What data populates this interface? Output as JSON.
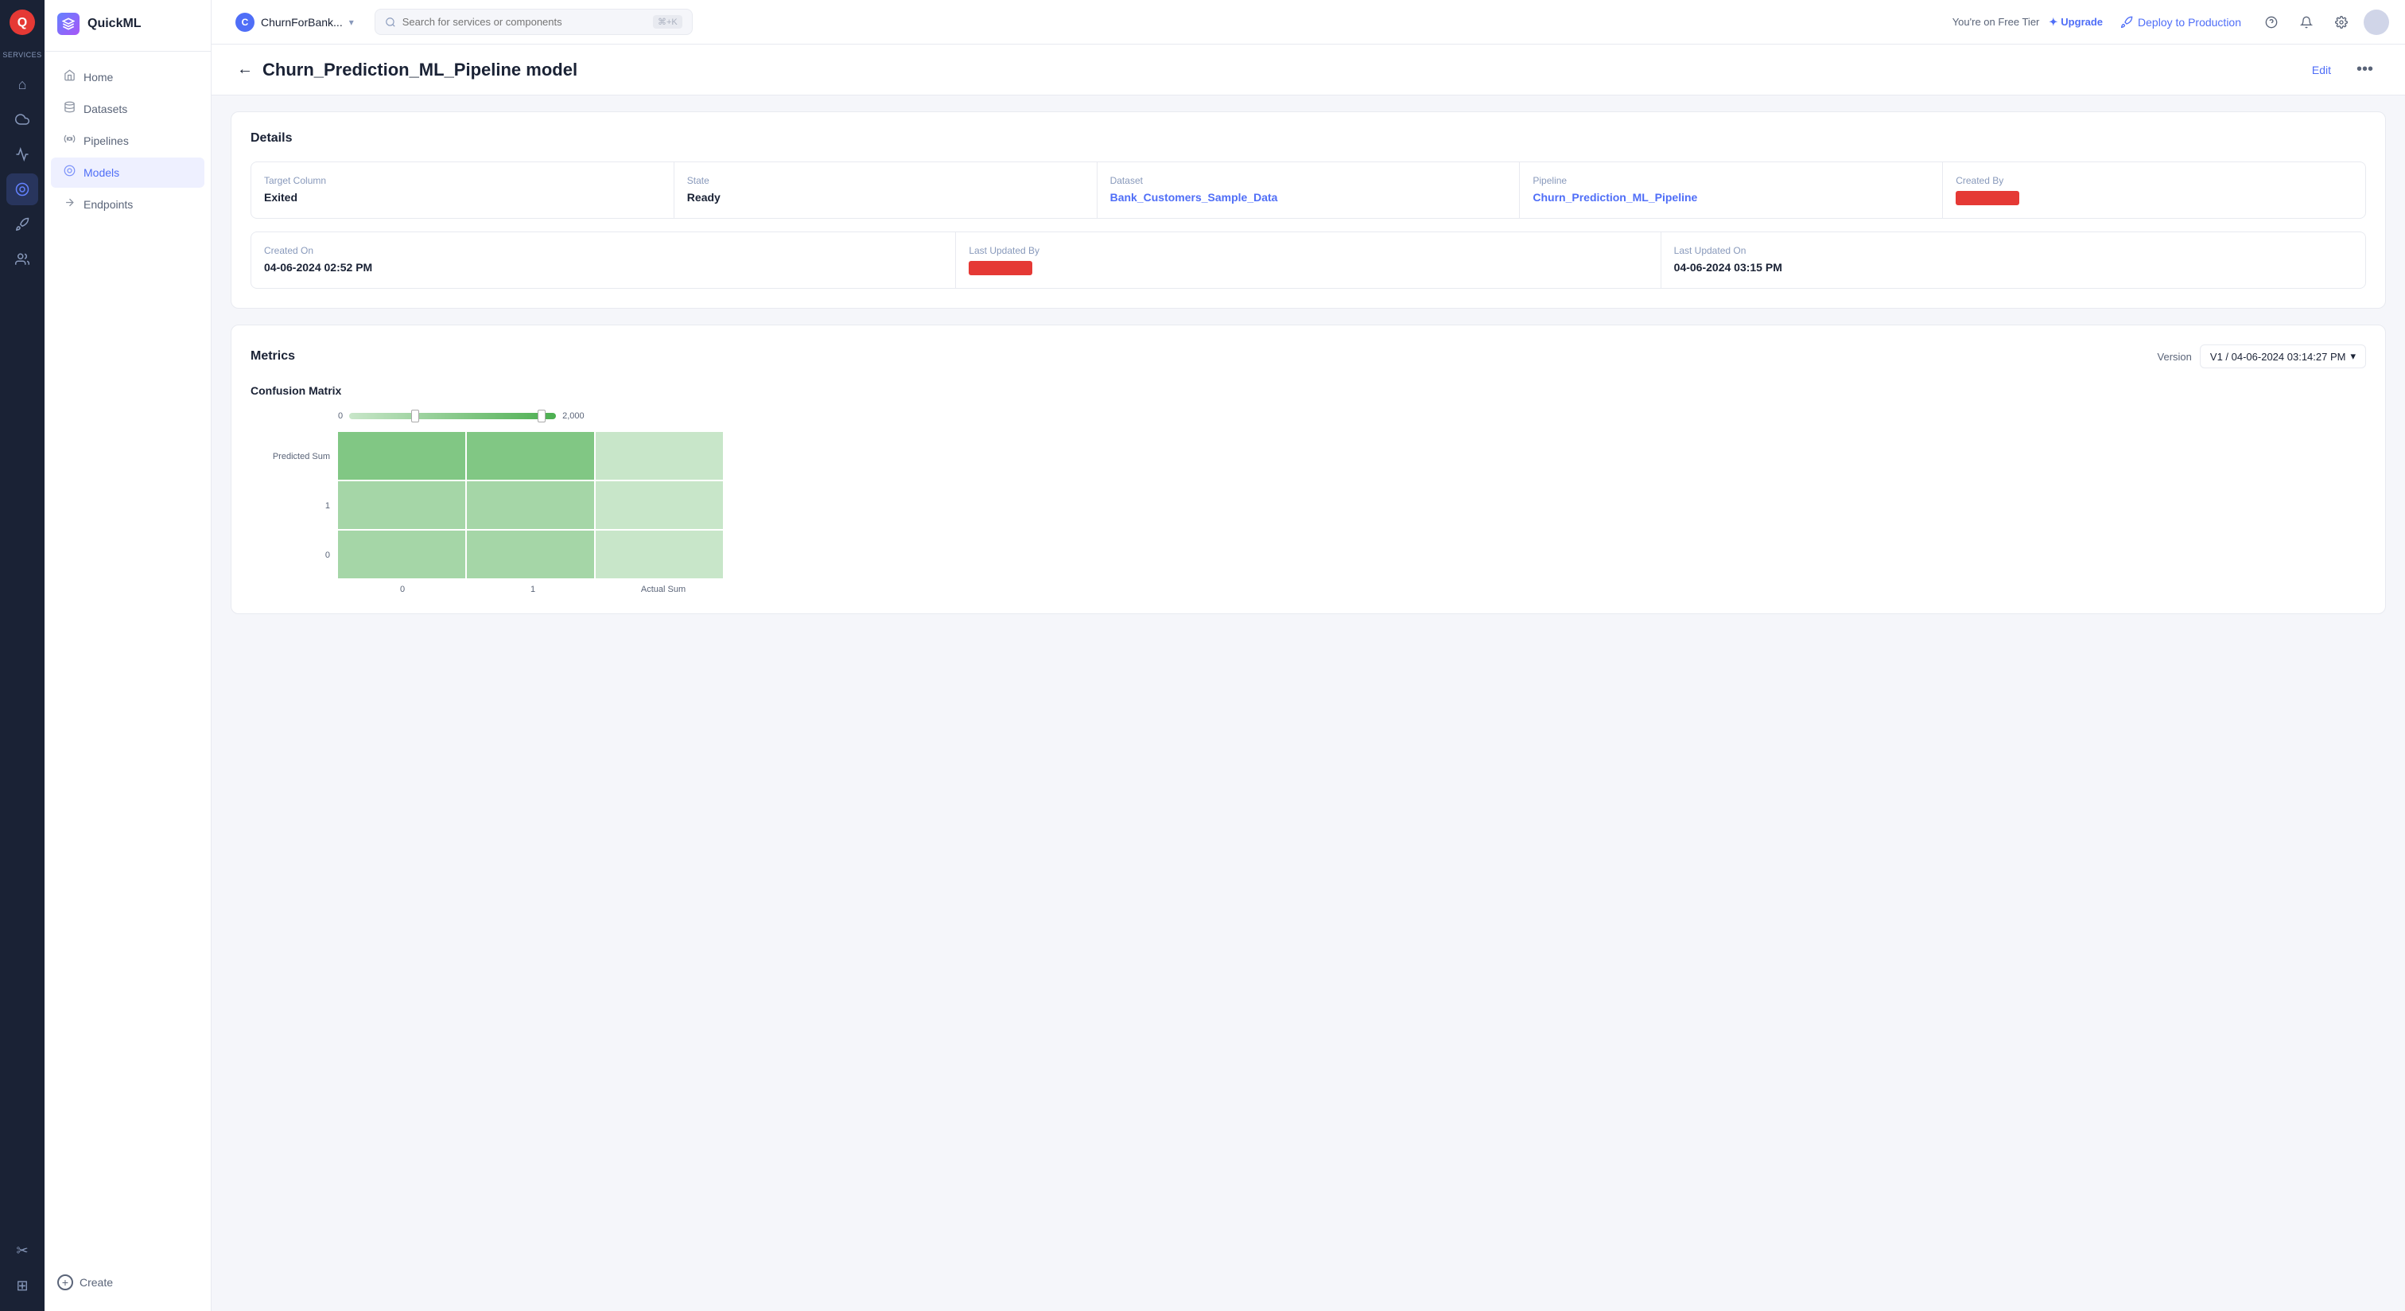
{
  "app": {
    "title": "QuickML",
    "logo_letter": "Q"
  },
  "rail": {
    "services_label": "Services",
    "icons": [
      {
        "name": "home-rail-icon",
        "glyph": "⌂",
        "active": false
      },
      {
        "name": "cloud-rail-icon",
        "glyph": "☁",
        "active": false
      },
      {
        "name": "chart-rail-icon",
        "glyph": "📊",
        "active": false
      },
      {
        "name": "model-rail-icon",
        "glyph": "◉",
        "active": true
      },
      {
        "name": "deploy-rail-icon",
        "glyph": "🚀",
        "active": false
      },
      {
        "name": "users-rail-icon",
        "glyph": "👥",
        "active": false
      }
    ],
    "bottom_icons": [
      {
        "name": "tools-rail-icon",
        "glyph": "✂"
      },
      {
        "name": "grid-rail-icon",
        "glyph": "⊞"
      }
    ]
  },
  "workspace": {
    "icon_letter": "C",
    "name": "ChurnForBank...",
    "chevron": "▾"
  },
  "search": {
    "placeholder": "Search for services or components",
    "shortcut": "⌘+K"
  },
  "topnav": {
    "tier_text": "You're on Free Tier",
    "upgrade_icon": "✦",
    "upgrade_label": "Upgrade",
    "deploy_icon": "🚀",
    "deploy_label": "Deploy to Production",
    "help_icon": "?",
    "bell_icon": "🔔",
    "settings_icon": "⚙"
  },
  "sidebar": {
    "brand_letter": "Q",
    "brand_name": "QuickML",
    "nav_items": [
      {
        "id": "home",
        "label": "Home",
        "icon": "⌂",
        "active": false
      },
      {
        "id": "datasets",
        "label": "Datasets",
        "icon": "🗄",
        "active": false
      },
      {
        "id": "pipelines",
        "label": "Pipelines",
        "icon": "⚙",
        "active": false
      },
      {
        "id": "models",
        "label": "Models",
        "icon": "◉",
        "active": true
      },
      {
        "id": "endpoints",
        "label": "Endpoints",
        "icon": "⊣",
        "active": false
      }
    ],
    "create_label": "Create"
  },
  "page": {
    "back_arrow": "←",
    "title": "Churn_Prediction_ML_Pipeline model",
    "edit_label": "Edit",
    "more_icon": "···"
  },
  "details_section": {
    "title": "Details",
    "row1": [
      {
        "label": "Target Column",
        "value": "Exited",
        "type": "text"
      },
      {
        "label": "State",
        "value": "Ready",
        "type": "text"
      },
      {
        "label": "Dataset",
        "value": "Bank_Customers_Sample_Data",
        "type": "link"
      },
      {
        "label": "Pipeline",
        "value": "Churn_Prediction_ML_Pipeline",
        "type": "link"
      },
      {
        "label": "Created By",
        "value": "████████████",
        "type": "redacted"
      }
    ],
    "row2": [
      {
        "label": "Created On",
        "value": "04-06-2024 02:52 PM",
        "type": "text"
      },
      {
        "label": "Last Updated By",
        "value": "████████████",
        "type": "redacted"
      },
      {
        "label": "Last Updated On",
        "value": "04-06-2024 03:15 PM",
        "type": "text"
      }
    ]
  },
  "metrics_section": {
    "title": "Metrics",
    "version_label": "Version",
    "version_value": "V1 / 04-06-2024 03:14:27 PM",
    "chevron": "▾",
    "confusion_matrix_title": "Confusion Matrix",
    "scale": {
      "min": "0",
      "max": "2,000"
    },
    "matrix": {
      "y_labels": [
        "Predicted Sum",
        "1",
        "0"
      ],
      "x_labels": [
        "0",
        "1",
        "Actual Sum"
      ],
      "cells": [
        {
          "row": 0,
          "col": 0,
          "color": "#81c784"
        },
        {
          "row": 0,
          "col": 1,
          "color": "#81c784"
        },
        {
          "row": 0,
          "col": 2,
          "color": "#c8e6c9"
        },
        {
          "row": 1,
          "col": 0,
          "color": "#a5d6a7"
        },
        {
          "row": 1,
          "col": 1,
          "color": "#a5d6a7"
        },
        {
          "row": 1,
          "col": 2,
          "color": "#c8e6c9"
        },
        {
          "row": 2,
          "col": 0,
          "color": "#a5d6a7"
        },
        {
          "row": 2,
          "col": 1,
          "color": "#a5d6a7"
        },
        {
          "row": 2,
          "col": 2,
          "color": "#c8e6c9"
        }
      ]
    }
  }
}
